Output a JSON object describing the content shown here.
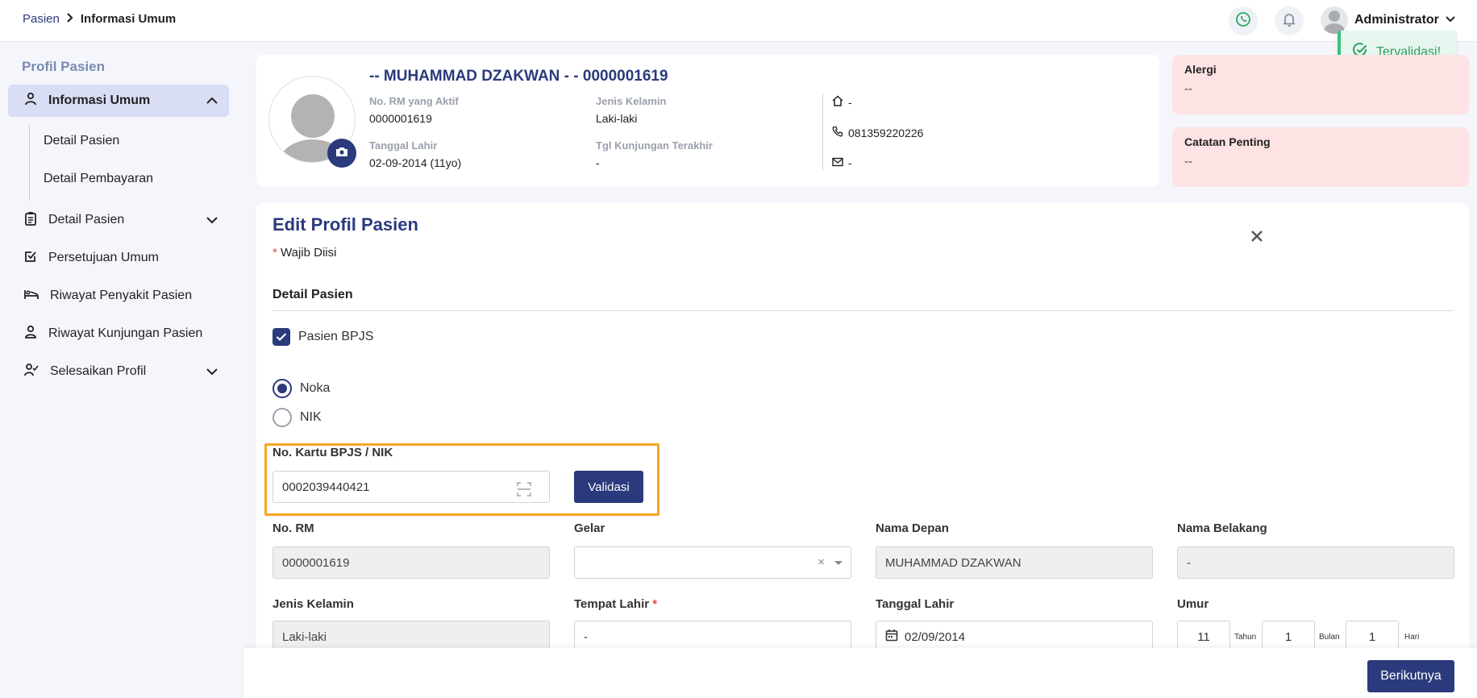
{
  "breadcrumb": {
    "parent": "Pasien",
    "current": "Informasi Umum"
  },
  "header": {
    "user_name": "Administrator"
  },
  "toast": {
    "message": "Tervalidasi!"
  },
  "sidebar": {
    "title": "Profil Pasien",
    "items": [
      {
        "label": "Informasi Umum"
      },
      {
        "label": "Detail Pasien"
      },
      {
        "label": "Persetujuan Umum"
      },
      {
        "label": "Riwayat Penyakit Pasien"
      },
      {
        "label": "Riwayat Kunjungan Pasien"
      },
      {
        "label": "Selesaikan Profil"
      }
    ],
    "subitems": [
      {
        "label": "Detail Pasien"
      },
      {
        "label": "Detail Pembayaran"
      }
    ]
  },
  "profile": {
    "name": "-- MUHAMMAD DZAKWAN - - 0000001619",
    "rm_label": "No. RM yang Aktif",
    "rm_value": "0000001619",
    "gender_label": "Jenis Kelamin",
    "gender_value": "Laki-laki",
    "dob_label": "Tanggal Lahir",
    "dob_value": "02-09-2014 (11yo)",
    "last_visit_label": "Tgl Kunjungan Terakhir",
    "last_visit_value": "-",
    "address": "-",
    "phone": "081359220226",
    "email": "-"
  },
  "alerts": {
    "allergy_title": "Alergi",
    "allergy_value": "--",
    "note_title": "Catatan Penting",
    "note_value": "--"
  },
  "form": {
    "title": "Edit Profil Pasien",
    "required_note": "Wajib Diisi",
    "section_title": "Detail Pasien",
    "bpjs_checkbox_label": "Pasien BPJS",
    "radio_noka": "Noka",
    "radio_nik": "NIK",
    "bpjs_field_label": "No. Kartu BPJS / NIK",
    "bpjs_value": "0002039440421",
    "validate_button": "Validasi",
    "rm_label": "No. RM",
    "rm_value": "0000001619",
    "title_label": "Gelar",
    "title_value": "",
    "title_clear": "×",
    "first_name_label": "Nama Depan",
    "first_name_value": "MUHAMMAD DZAKWAN",
    "last_name_label": "Nama Belakang",
    "last_name_value": "-",
    "gender_label": "Jenis Kelamin",
    "gender_value": "Laki-laki",
    "birthplace_label": "Tempat Lahir",
    "birthplace_value": "-",
    "birthdate_label": "Tanggal Lahir",
    "birthdate_value": "02/09/2014",
    "age_label": "Umur",
    "age_years": "11",
    "age_years_unit": "Tahun",
    "age_months": "1",
    "age_months_unit": "Bulan",
    "age_days": "1",
    "age_days_unit": "Hari"
  },
  "footer": {
    "next_button": "Berikutnya"
  }
}
